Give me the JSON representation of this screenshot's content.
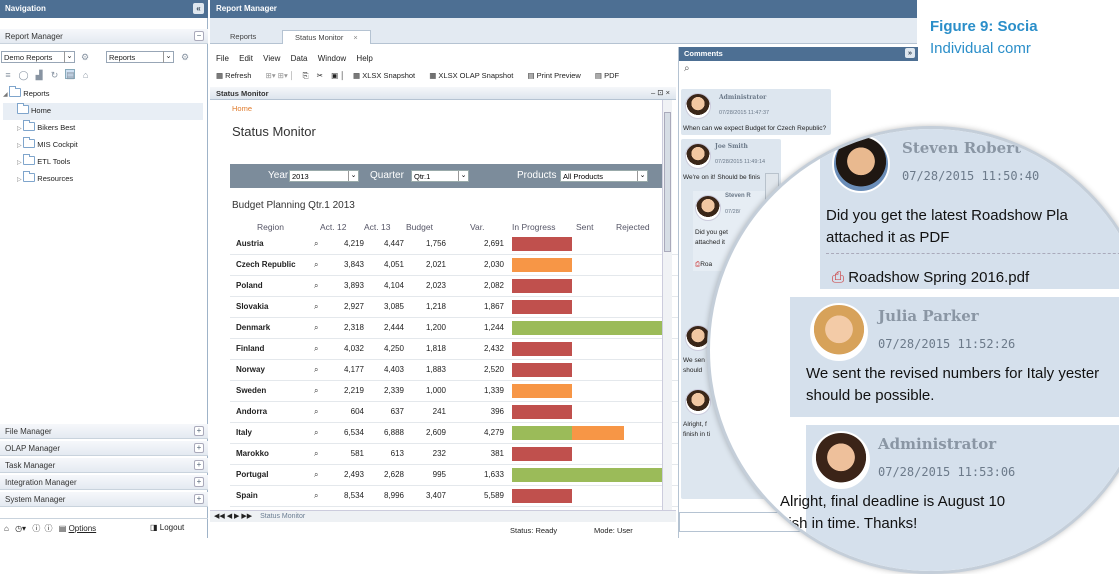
{
  "figure": {
    "label": "Figure 9:",
    "title": "Socia",
    "subtitle": "Individual comr"
  },
  "nav": {
    "title": "Navigation",
    "collapse_icon": "«",
    "report_manager": "Report Manager",
    "demo_select": "Demo Reports",
    "reports_select": "Reports",
    "tree": [
      {
        "label": "Reports",
        "level": 0
      },
      {
        "label": "Home",
        "level": 1
      },
      {
        "label": "Bikers Best",
        "level": 1
      },
      {
        "label": "MIS Cockpit",
        "level": 1
      },
      {
        "label": "ETL Tools",
        "level": 1
      },
      {
        "label": "Resources",
        "level": 1
      }
    ],
    "sections": [
      "File Manager",
      "OLAP Manager",
      "Task Manager",
      "Integration Manager",
      "System Manager"
    ],
    "footer": {
      "options": "Options",
      "logout": "Logout"
    }
  },
  "report_manager": {
    "title": "Report Manager",
    "tabs": [
      "Reports",
      "Status Monitor"
    ],
    "menu": [
      "File",
      "Edit",
      "View",
      "Data",
      "Window",
      "Help"
    ],
    "toolbar": [
      "Refresh",
      "XLSX Snapshot",
      "XLSX OLAP Snapshot",
      "Print Preview",
      "PDF"
    ],
    "panel_title": "Status Monitor",
    "breadcrumb": "Home",
    "heading": "Status Monitor",
    "filters": {
      "year_label": "Year",
      "year": "2013",
      "quarter_label": "Quarter",
      "quarter": "Qtr.1",
      "products_label": "Products",
      "products": "All Products"
    },
    "table_title": "Budget Planning Qtr.1 2013",
    "columns": [
      "Region",
      "Act. 12",
      "Act. 13",
      "Budget",
      "Var.",
      "In Progress",
      "Sent",
      "Rejected"
    ],
    "sheet_tab": "Status Monitor",
    "status": {
      "status_label": "Status:",
      "status": "Ready",
      "mode_label": "Mode:",
      "mode": "User"
    }
  },
  "rows": [
    {
      "region": "Austria",
      "a12": "4,219",
      "a13": "4,447",
      "budget": "1,756",
      "var": "2,691",
      "color": "#c0504d",
      "start": 0,
      "len": 0.38
    },
    {
      "region": "Czech Republic",
      "a12": "3,843",
      "a13": "4,051",
      "budget": "2,021",
      "var": "2,030",
      "color": "#f79646",
      "start": 0,
      "len": 0.38
    },
    {
      "region": "Poland",
      "a12": "3,893",
      "a13": "4,104",
      "budget": "2,023",
      "var": "2,082",
      "color": "#c0504d",
      "start": 0,
      "len": 0.38
    },
    {
      "region": "Slovakia",
      "a12": "2,927",
      "a13": "3,085",
      "budget": "1,218",
      "var": "1,867",
      "color": "#c0504d",
      "start": 0,
      "len": 0.38
    },
    {
      "region": "Denmark",
      "a12": "2,318",
      "a13": "2,444",
      "budget": "1,200",
      "var": "1,244",
      "color": "#9bbb59",
      "start": 0,
      "len": 1.0
    },
    {
      "region": "Finland",
      "a12": "4,032",
      "a13": "4,250",
      "budget": "1,818",
      "var": "2,432",
      "color": "#c0504d",
      "start": 0,
      "len": 0.38
    },
    {
      "region": "Norway",
      "a12": "4,177",
      "a13": "4,403",
      "budget": "1,883",
      "var": "2,520",
      "color": "#c0504d",
      "start": 0,
      "len": 0.38
    },
    {
      "region": "Sweden",
      "a12": "2,219",
      "a13": "2,339",
      "budget": "1,000",
      "var": "1,339",
      "color": "#f79646",
      "start": 0,
      "len": 0.38
    },
    {
      "region": "Andorra",
      "a12": "604",
      "a13": "637",
      "budget": "241",
      "var": "396",
      "color": "#c0504d",
      "start": 0,
      "len": 0.38
    },
    {
      "region": "Italy",
      "a12": "6,534",
      "a13": "6,888",
      "budget": "2,609",
      "var": "4,279",
      "color": "#9bbb59",
      "start": 0,
      "len": 0.38,
      "extra": {
        "color": "#f79646",
        "start": 0.38,
        "len": 0.33
      }
    },
    {
      "region": "Marokko",
      "a12": "581",
      "a13": "613",
      "budget": "232",
      "var": "381",
      "color": "#c0504d",
      "start": 0,
      "len": 0.38
    },
    {
      "region": "Portugal",
      "a12": "2,493",
      "a13": "2,628",
      "budget": "995",
      "var": "1,633",
      "color": "#9bbb59",
      "start": 0,
      "len": 1.0
    },
    {
      "region": "Spain",
      "a12": "8,534",
      "a13": "8,996",
      "budget": "3,407",
      "var": "5,589",
      "color": "#c0504d",
      "start": 0,
      "len": 0.38
    }
  ],
  "comments": {
    "title": "Comments",
    "items": [
      {
        "name": "Administrator",
        "time": "07/28/2015 11:47:37",
        "text": "When can we expect Budget for Czech Republic?"
      },
      {
        "name": "Joe Smith",
        "time": "07/28/2015 11:49:14",
        "text": "We're on it! Should be finis"
      },
      {
        "name": "Steven R",
        "time": "07/28/",
        "text": "Did you get"
      },
      {
        "name": "",
        "time": "",
        "text": "attached it"
      },
      {
        "name": "",
        "time": "",
        "text": "Roa"
      },
      {
        "name": "",
        "time": "",
        "text": "We sen"
      },
      {
        "name": "",
        "time": "",
        "text": "should"
      },
      {
        "name": "",
        "time": "",
        "text": "Alright, f"
      },
      {
        "name": "",
        "time": "",
        "text": "finish in ti"
      }
    ]
  },
  "magnified": [
    {
      "name": "Steven Robert",
      "time": "07/28/2015 11:50:40",
      "line1": "Did you get the latest Roadshow Pla",
      "line2": "attached it as PDF",
      "attachment": "Roadshow Spring 2016.pdf"
    },
    {
      "name": "Julia Parker",
      "time": "07/28/2015 11:52:26",
      "line1": "We sent the revised numbers for Italy yester",
      "line2": "should be possible."
    },
    {
      "name": "Administrator",
      "time": "07/28/2015 11:53:06",
      "line1": "Alright, final deadline is August 10",
      "line2": "nish in time. Thanks!"
    }
  ]
}
